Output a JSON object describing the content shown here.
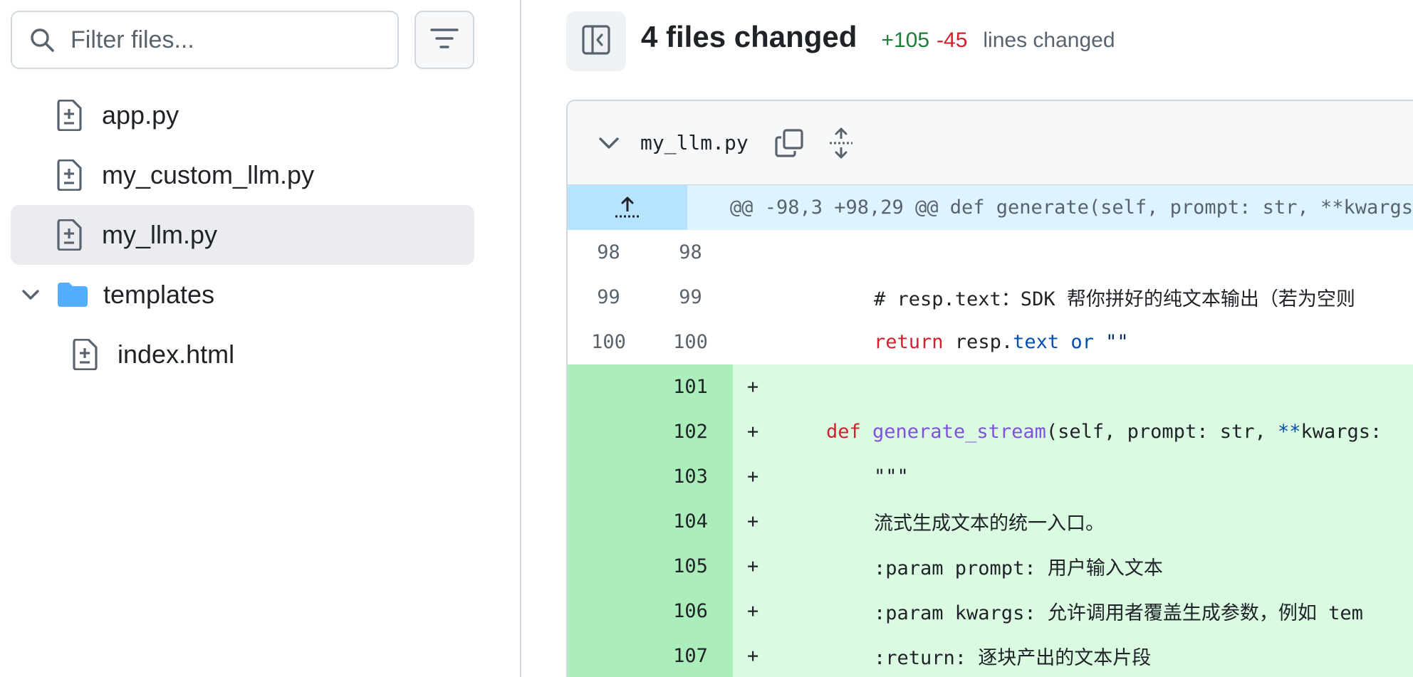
{
  "sidebar": {
    "filter": {
      "placeholder": "Filter files..."
    },
    "tree": [
      {
        "label": "app.py",
        "type": "file"
      },
      {
        "label": "my_custom_llm.py",
        "type": "file"
      },
      {
        "label": "my_llm.py",
        "type": "file",
        "selected": true
      },
      {
        "label": "templates",
        "type": "folder",
        "expanded": true
      },
      {
        "label": "index.html",
        "type": "file"
      }
    ]
  },
  "summary": {
    "files_changed": "4 files changed",
    "additions": "+105",
    "deletions": "-45",
    "lines_label": "lines changed"
  },
  "diff": {
    "filename": "my_llm.py",
    "hunk": "@@ -98,3 +98,29 @@ def generate(self, prompt: str, **kwargs",
    "lines": [
      {
        "old": "98",
        "new": "98",
        "sign": "",
        "type": "context",
        "text": ""
      },
      {
        "old": "99",
        "new": "99",
        "sign": "",
        "type": "context",
        "text": "# resp.text：SDK 帮你拼好的纯文本输出（若为空则"
      },
      {
        "old": "100",
        "new": "100",
        "sign": "",
        "type": "context",
        "kw": "return",
        "ident": " resp.",
        "attr": "text",
        "kw2": " or ",
        "str": "\"\""
      },
      {
        "old": "",
        "new": "101",
        "sign": "+",
        "type": "add",
        "text": ""
      },
      {
        "old": "",
        "new": "102",
        "sign": "+",
        "type": "add",
        "kw": "def ",
        "fn": "generate_stream",
        "rest1": "(self, prompt: str, ",
        "op": "**",
        "rest2": "kwargs:"
      },
      {
        "old": "",
        "new": "103",
        "sign": "+",
        "type": "add",
        "str": "\"\"\""
      },
      {
        "old": "",
        "new": "104",
        "sign": "+",
        "type": "add",
        "str": "流式生成文本的统一入口。"
      },
      {
        "old": "",
        "new": "105",
        "sign": "+",
        "type": "add",
        "str": ":param prompt: 用户输入文本"
      },
      {
        "old": "",
        "new": "106",
        "sign": "+",
        "type": "add",
        "str": ":param kwargs: 允许调用者覆盖生成参数，例如 tem"
      },
      {
        "old": "",
        "new": "107",
        "sign": "+",
        "type": "add",
        "str": ":return: 逐块产出的文本片段"
      }
    ]
  },
  "colors": {
    "addition": "#1a7f37",
    "deletion": "#cf222e",
    "add_gutter": "#aceebb",
    "add_line": "#dafbe1",
    "hunk_gutter": "#b6e3ff",
    "hunk_line": "#ddf4ff"
  },
  "icons": [
    "search-icon",
    "filter-lines-icon",
    "file-diff-icon",
    "folder-icon",
    "chevron-down-icon",
    "sidebar-toggle-icon",
    "copy-icon",
    "expand-vertical-icon",
    "expand-up-icon"
  ]
}
